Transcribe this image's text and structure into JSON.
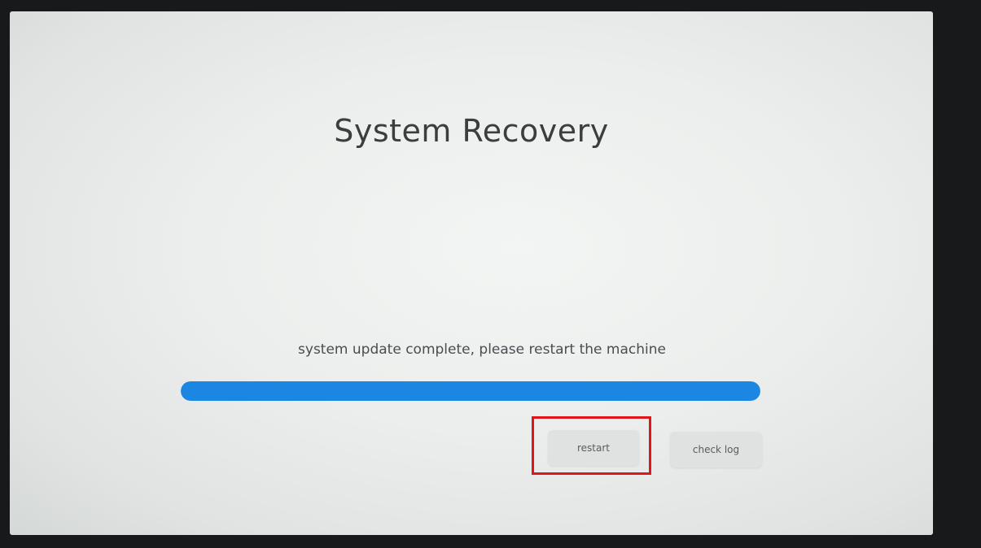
{
  "title": "System Recovery",
  "status_text": "system update complete, please restart the machine",
  "progress": {
    "value": 1.0,
    "color": "#1b87e3"
  },
  "buttons": {
    "restart_label": "restart",
    "check_log_label": "check log"
  },
  "highlight": {
    "color": "#e0161b",
    "target": "restart-button"
  }
}
